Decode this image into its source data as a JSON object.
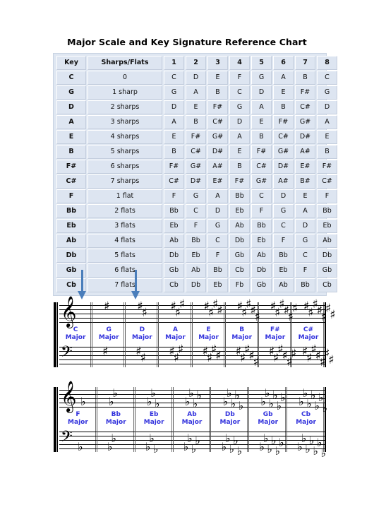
{
  "page": {
    "title": "Major Scale and Key Signature Reference Chart",
    "accent_blue": "#3333dd",
    "arrow_color": "#4a7ebb",
    "table_cell_bg": "#dde5f1"
  },
  "table": {
    "headers": [
      "Key",
      "Sharps/Flats",
      "1",
      "2",
      "3",
      "4",
      "5",
      "6",
      "7",
      "8"
    ],
    "rows": [
      {
        "key": "C",
        "signature": "0",
        "degrees": [
          "C",
          "D",
          "E",
          "F",
          "G",
          "A",
          "B",
          "C"
        ]
      },
      {
        "key": "G",
        "signature": "1 sharp",
        "degrees": [
          "G",
          "A",
          "B",
          "C",
          "D",
          "E",
          "F#",
          "G"
        ]
      },
      {
        "key": "D",
        "signature": "2 sharps",
        "degrees": [
          "D",
          "E",
          "F#",
          "G",
          "A",
          "B",
          "C#",
          "D"
        ]
      },
      {
        "key": "A",
        "signature": "3 sharps",
        "degrees": [
          "A",
          "B",
          "C#",
          "D",
          "E",
          "F#",
          "G#",
          "A"
        ]
      },
      {
        "key": "E",
        "signature": "4 sharps",
        "degrees": [
          "E",
          "F#",
          "G#",
          "A",
          "B",
          "C#",
          "D#",
          "E"
        ]
      },
      {
        "key": "B",
        "signature": "5 sharps",
        "degrees": [
          "B",
          "C#",
          "D#",
          "E",
          "F#",
          "G#",
          "A#",
          "B"
        ]
      },
      {
        "key": "F#",
        "signature": "6 sharps",
        "degrees": [
          "F#",
          "G#",
          "A#",
          "B",
          "C#",
          "D#",
          "E#",
          "F#"
        ]
      },
      {
        "key": "C#",
        "signature": "7 sharps",
        "degrees": [
          "C#",
          "D#",
          "E#",
          "F#",
          "G#",
          "A#",
          "B#",
          "C#"
        ]
      },
      {
        "key": "F",
        "signature": "1 flat",
        "degrees": [
          "F",
          "G",
          "A",
          "Bb",
          "C",
          "D",
          "E",
          "F"
        ]
      },
      {
        "key": "Bb",
        "signature": "2 flats",
        "degrees": [
          "Bb",
          "C",
          "D",
          "Eb",
          "F",
          "G",
          "A",
          "Bb"
        ]
      },
      {
        "key": "Eb",
        "signature": "3 flats",
        "degrees": [
          "Eb",
          "F",
          "G",
          "Ab",
          "Bb",
          "C",
          "D",
          "Eb"
        ]
      },
      {
        "key": "Ab",
        "signature": "4 flats",
        "degrees": [
          "Ab",
          "Bb",
          "C",
          "Db",
          "Eb",
          "F",
          "G",
          "Ab"
        ]
      },
      {
        "key": "Db",
        "signature": "5 flats",
        "degrees": [
          "Db",
          "Eb",
          "F",
          "Gb",
          "Ab",
          "Bb",
          "C",
          "Db"
        ]
      },
      {
        "key": "Gb",
        "signature": "6 flats",
        "degrees": [
          "Gb",
          "Ab",
          "Bb",
          "Cb",
          "Db",
          "Eb",
          "F",
          "Gb"
        ]
      },
      {
        "key": "Cb",
        "signature": "7 flats",
        "degrees": [
          "Cb",
          "Db",
          "Eb",
          "Fb",
          "Gb",
          "Ab",
          "Bb",
          "Cb"
        ]
      }
    ]
  },
  "arrows": [
    {
      "name": "arrow-to-sharps-staff"
    },
    {
      "name": "arrow-to-sharps-staff-2"
    }
  ],
  "staff_systems": [
    {
      "name": "sharp-keys-system",
      "clef_top": "treble-clef",
      "clef_bottom": "bass-clef",
      "accidental_glyph": "♯",
      "measures": [
        {
          "name": "C",
          "line2": "Major",
          "accidental_count": 0
        },
        {
          "name": "G",
          "line2": "Major",
          "accidental_count": 1
        },
        {
          "name": "D",
          "line2": "Major",
          "accidental_count": 2
        },
        {
          "name": "A",
          "line2": "Major",
          "accidental_count": 3
        },
        {
          "name": "E",
          "line2": "Major",
          "accidental_count": 4
        },
        {
          "name": "B",
          "line2": "Major",
          "accidental_count": 5
        },
        {
          "name": "F#",
          "line2": "Major",
          "accidental_count": 6
        },
        {
          "name": "C#",
          "line2": "Major",
          "accidental_count": 7
        }
      ]
    },
    {
      "name": "flat-keys-system",
      "clef_top": "treble-clef",
      "clef_bottom": "bass-clef",
      "accidental_glyph": "♭",
      "measures": [
        {
          "name": "F",
          "line2": "Major",
          "accidental_count": 1
        },
        {
          "name": "Bb",
          "line2": "Major",
          "accidental_count": 2
        },
        {
          "name": "Eb",
          "line2": "Major",
          "accidental_count": 3
        },
        {
          "name": "Ab",
          "line2": "Major",
          "accidental_count": 4
        },
        {
          "name": "Db",
          "line2": "Major",
          "accidental_count": 5
        },
        {
          "name": "Gb",
          "line2": "Major",
          "accidental_count": 6
        },
        {
          "name": "Cb",
          "line2": "Major",
          "accidental_count": 7
        }
      ]
    }
  ]
}
